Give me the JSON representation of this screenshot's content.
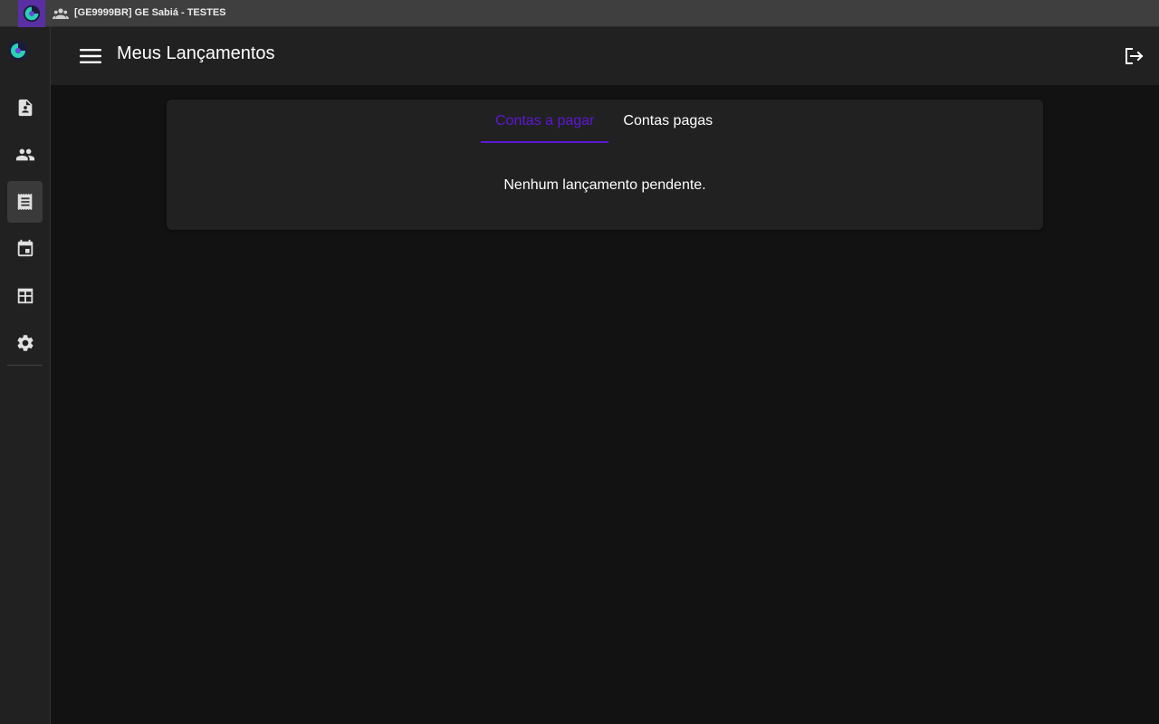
{
  "window": {
    "title": "[GE9999BR] GE Sabiá - TESTES"
  },
  "header": {
    "title": "Meus Lançamentos"
  },
  "sidebar": {
    "items": [
      {
        "icon": "contact-document-icon",
        "active": false
      },
      {
        "icon": "people-icon",
        "active": false
      },
      {
        "icon": "receipt-icon",
        "active": true
      },
      {
        "icon": "calendar-event-icon",
        "active": false
      },
      {
        "icon": "table-layout-icon",
        "active": false
      },
      {
        "icon": "gear-icon",
        "active": false
      }
    ]
  },
  "tabs": [
    {
      "label": "Contas a pagar",
      "active": true
    },
    {
      "label": "Contas pagas",
      "active": false
    }
  ],
  "content": {
    "empty_message": "Nenhum lançamento pendente."
  },
  "colors": {
    "accent": "#5e17d6",
    "background": "#121212",
    "surface": "#212121"
  }
}
